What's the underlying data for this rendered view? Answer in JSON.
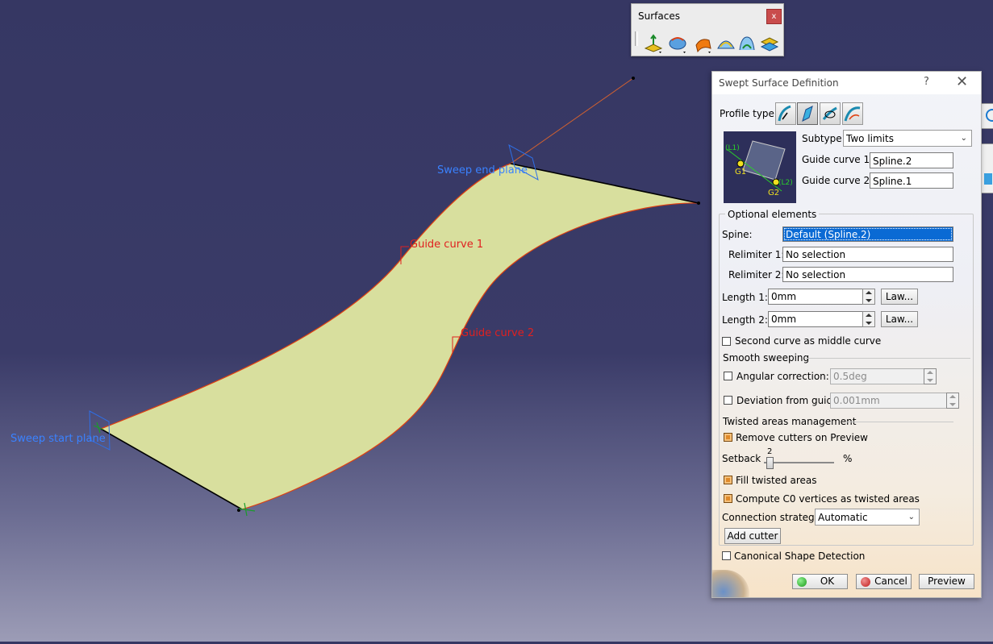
{
  "viewport": {
    "labels": {
      "sweep_end_plane": "Sweep end plane",
      "sweep_start_plane": "Sweep start plane",
      "guide_curve_1": "Guide curve 1",
      "guide_curve_2": "Guide curve 2"
    },
    "surface_color": "#d8df9e",
    "plane_color": "#2f6fe6",
    "guide_color": "#e04010"
  },
  "toolbar": {
    "title": "Surfaces",
    "close": "x",
    "icons": [
      "extrude-icon",
      "revolve-icon",
      "sweep-icon",
      "fill-icon",
      "blend-icon",
      "offset-icon"
    ]
  },
  "dialog": {
    "title": "Swept Surface Definition",
    "help": "?",
    "close": "✕",
    "profile_type_label": "Profile type:",
    "profile_types": [
      "explicit",
      "line",
      "circle",
      "conic"
    ],
    "subtype_label": "Subtype:",
    "subtype_value": "Two limits",
    "guide_curve_1_label": "Guide curve 1:",
    "guide_curve_1_value": "Spline.2",
    "guide_curve_2_label": "Guide curve 2:",
    "guide_curve_2_value": "Spline.1",
    "preview_labels": {
      "l1": "(L1)",
      "l2": "(L2)",
      "g1": "G1",
      "g2": "G2"
    },
    "optional": {
      "title": "Optional elements",
      "spine_label": "Spine:",
      "spine_value": "Default (Spline.2)",
      "relimiter1_label": "Relimiter 1:",
      "relimiter1_value": "No selection",
      "relimiter2_label": "Relimiter 2:",
      "relimiter2_value": "No selection",
      "length1_label": "Length 1:",
      "length1_value": "0mm",
      "length2_label": "Length 2:",
      "length2_value": "0mm",
      "law_label": "Law...",
      "second_curve_label": "Second curve as middle curve",
      "smooth_title": "Smooth sweeping",
      "angular_label": "Angular correction:",
      "angular_value": "0.5deg",
      "deviation_label": "Deviation from guide(s):",
      "deviation_value": "0.001mm",
      "twisted_title": "Twisted areas management",
      "remove_cutters_label": "Remove cutters on Preview",
      "setback_label": "Setback",
      "setback_value": "2",
      "setback_fraction": 0.04,
      "percent": "%",
      "fill_twisted_label": "Fill twisted areas",
      "compute_c0_label": "Compute C0 vertices as twisted areas",
      "connection_label": "Connection strategy:",
      "connection_value": "Automatic",
      "add_cutter_label": "Add cutter"
    },
    "canonical_label": "Canonical Shape Detection",
    "ok_label": "OK",
    "cancel_label": "Cancel",
    "preview_label": "Preview"
  }
}
